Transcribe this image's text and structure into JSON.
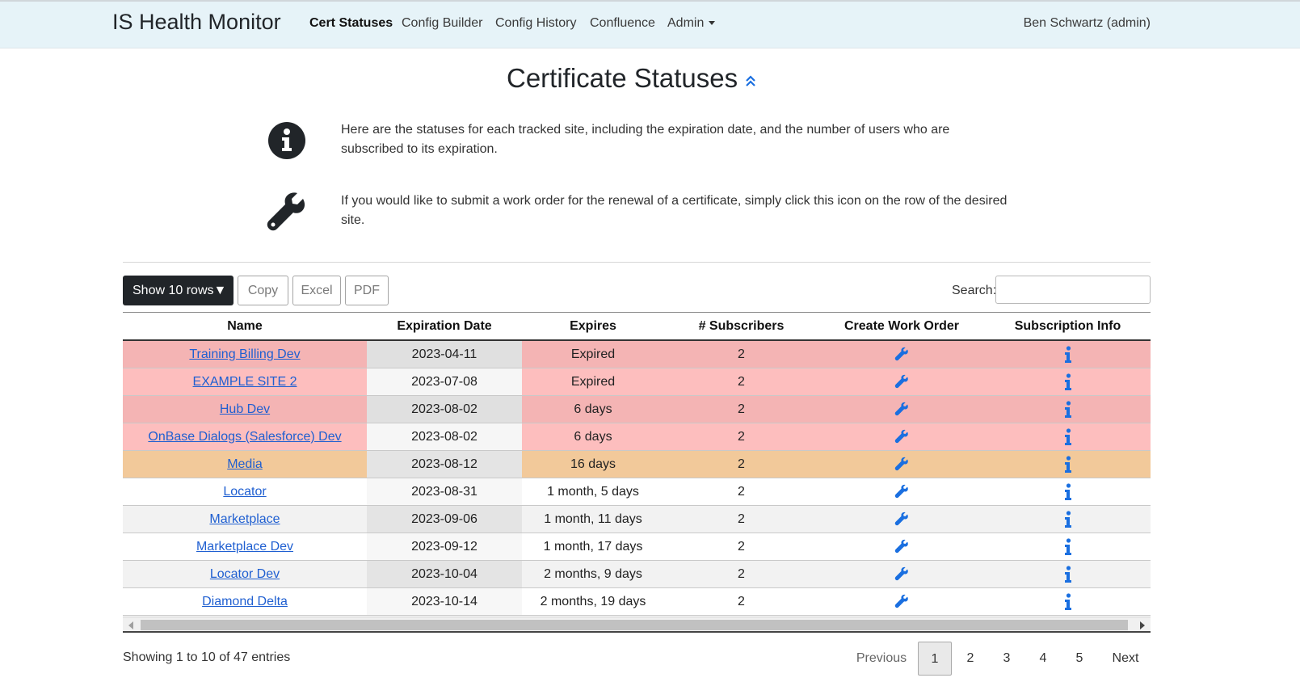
{
  "navbar": {
    "brand": "IS Health Monitor",
    "items": [
      {
        "label": "Cert Statuses",
        "active": true
      },
      {
        "label": "Config Builder"
      },
      {
        "label": "Config History"
      },
      {
        "label": "Confluence"
      },
      {
        "label": "Admin"
      }
    ],
    "user": "Ben Schwartz (admin)"
  },
  "page": {
    "title": "Certificate Statuses",
    "info_text": "Here are the statuses for each tracked site, including the expiration date, and the number of users who are subscribed to its expiration.",
    "wrench_text": "If you would like to submit a work order for the renewal of a certificate, simply click this icon on the row of the desired site."
  },
  "toolbar": {
    "show_rows_label": "Show 10 rows▼",
    "copy_label": "Copy",
    "excel_label": "Excel",
    "pdf_label": "PDF",
    "search_label": "Search:",
    "search_value": ""
  },
  "table": {
    "headers": [
      "Name",
      "Expiration Date",
      "Expires",
      "# Subscribers",
      "Create Work Order",
      "Subscription Info"
    ],
    "rows": [
      {
        "name": "Training Billing Dev",
        "date": "2023-04-11",
        "expires": "Expired",
        "subs": "2"
      },
      {
        "name": "EXAMPLE SITE 2",
        "date": "2023-07-08",
        "expires": "Expired",
        "subs": "2"
      },
      {
        "name": "Hub Dev",
        "date": "2023-08-02",
        "expires": "6 days",
        "subs": "2"
      },
      {
        "name": "OnBase Dialogs (Salesforce) Dev",
        "date": "2023-08-02",
        "expires": "6 days",
        "subs": "2"
      },
      {
        "name": "Media",
        "date": "2023-08-12",
        "expires": "16 days",
        "subs": "2"
      },
      {
        "name": "Locator",
        "date": "2023-08-31",
        "expires": "1 month, 5 days",
        "subs": "2"
      },
      {
        "name": "Marketplace",
        "date": "2023-09-06",
        "expires": "1 month, 11 days",
        "subs": "2"
      },
      {
        "name": "Marketplace Dev",
        "date": "2023-09-12",
        "expires": "1 month, 17 days",
        "subs": "2"
      },
      {
        "name": "Locator Dev",
        "date": "2023-10-04",
        "expires": "2 months, 9 days",
        "subs": "2"
      },
      {
        "name": "Diamond Delta",
        "date": "2023-10-14",
        "expires": "2 months, 19 days",
        "subs": "2"
      }
    ]
  },
  "footer": {
    "showing": "Showing 1 to 10 of 47 entries",
    "previous": "Previous",
    "pages": [
      "1",
      "2",
      "3",
      "4",
      "5"
    ],
    "next": "Next"
  },
  "colors": {
    "expired_row": "#f4b4b4",
    "warning_row": "#f2c99a",
    "link": "#1f5fd1",
    "icon_blue": "#1a6fe0"
  }
}
